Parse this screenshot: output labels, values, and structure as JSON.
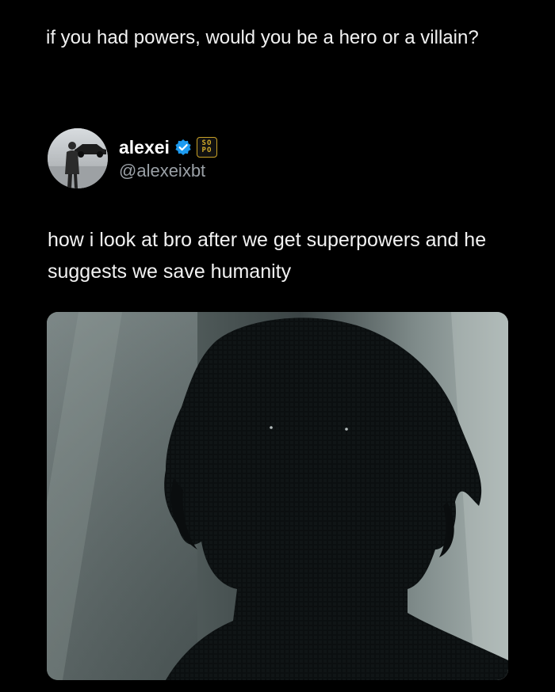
{
  "post": {
    "caption": "if you had powers, would you be a hero or a villain?"
  },
  "tweet": {
    "author": {
      "display_name": "alexei",
      "handle": "@alexeixbt",
      "verified_icon": "verified-check-icon",
      "affiliate_badge": {
        "line1": "SO",
        "line2": "PO"
      }
    },
    "text": "how i look at bro after we get superpowers and he suggests we save humanity",
    "media": {
      "kind": "image",
      "icon": "silhouette-portrait-image"
    }
  },
  "colors": {
    "background": "#000000",
    "text": "#f2f2f2",
    "handle": "#9aa0a6",
    "verified": "#1d9bf0",
    "badge": "#c9a227"
  }
}
